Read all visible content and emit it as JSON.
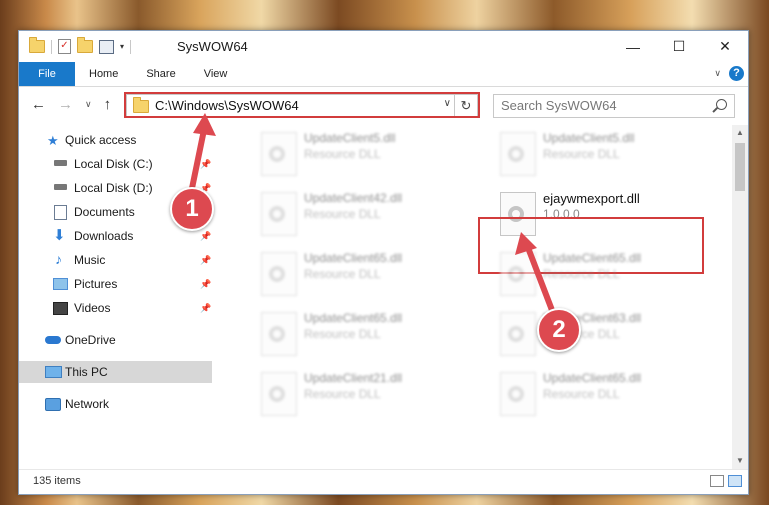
{
  "window": {
    "title": "SysWOW64"
  },
  "ribbon": {
    "tabs": [
      {
        "label": "File"
      },
      {
        "label": "Home"
      },
      {
        "label": "Share"
      },
      {
        "label": "View"
      }
    ]
  },
  "address": {
    "path": "C:\\Windows\\SysWOW64"
  },
  "search": {
    "placeholder": "Search SysWOW64"
  },
  "sidebar": {
    "items": [
      {
        "label": "Quick access"
      },
      {
        "label": "Local Disk (C:)"
      },
      {
        "label": "Local Disk (D:)"
      },
      {
        "label": "Documents"
      },
      {
        "label": "Downloads"
      },
      {
        "label": "Music"
      },
      {
        "label": "Pictures"
      },
      {
        "label": "Videos"
      },
      {
        "label": "OneDrive"
      },
      {
        "label": "This PC"
      },
      {
        "label": "Network"
      }
    ]
  },
  "files": [
    {
      "name": "UpdateClient5.dll",
      "type": "Resource DLL"
    },
    {
      "name": "UpdateClient5.dll",
      "type": "Resource DLL"
    },
    {
      "name": "UpdateClient42.dll",
      "type": "Resource DLL"
    },
    {
      "name": "ejaywmexport.dll",
      "type": "1.0.0.0"
    },
    {
      "name": "UpdateClient65.dll",
      "type": "Resource DLL"
    },
    {
      "name": "UpdateClient65.dll",
      "type": "Resource DLL"
    },
    {
      "name": "UpdateClient65.dll",
      "type": "Resource DLL"
    },
    {
      "name": "UpdateClient63.dll",
      "type": "Resource DLL"
    },
    {
      "name": "UpdateClient21.dll",
      "type": "Resource DLL"
    },
    {
      "name": "UpdateClient65.dll",
      "type": "Resource DLL"
    }
  ],
  "status": {
    "items_count": "135 items"
  },
  "annotations": {
    "step1": "1",
    "step2": "2",
    "highlight_color": "#d23c3c",
    "badge_color": "#dd4950"
  },
  "icons": [
    "folder-icon",
    "checklist-icon",
    "properties-icon",
    "help-icon",
    "back-arrow-icon",
    "forward-arrow-icon",
    "up-arrow-icon",
    "refresh-icon",
    "search-icon",
    "pin-icon",
    "star-icon",
    "drive-icon",
    "documents-icon",
    "downloads-icon",
    "music-icon",
    "pictures-icon",
    "videos-icon",
    "onedrive-icon",
    "pc-icon",
    "network-icon",
    "dll-file-icon"
  ]
}
